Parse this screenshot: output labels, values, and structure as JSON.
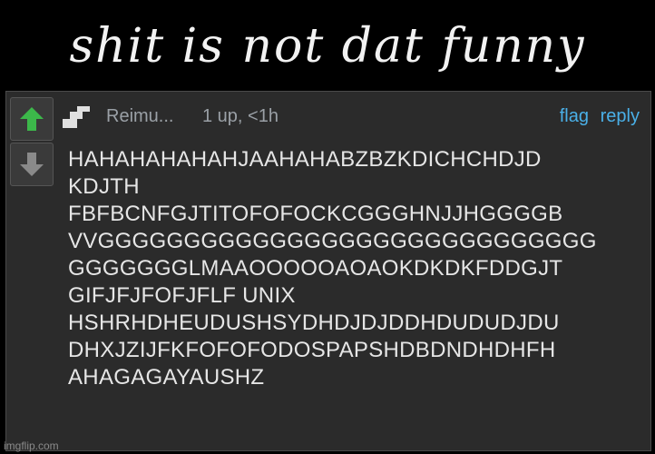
{
  "caption": "shit is not dat funny",
  "comment": {
    "username": "Reimu...",
    "meta": "1 up, <1h",
    "actions": {
      "flag": "flag",
      "reply": "reply"
    },
    "lines": [
      "HAHAHAHAHAHJAAHAHABZBZKDICHCHDJD",
      "KDJTH",
      "FBFBCNFGJTITOFOFOCKCGGGHNJJHGGGGB",
      "VVGGGGGGGGGGGGGGGGGGGGGGGGGGGGG",
      "GGGGGGGLMAAOOOOOAOAOKDKDKFDDGJT",
      "GIFJFJFOFJFLF UNIX",
      "HSHRHDHEUDUSHSYDHDJDJDDHDUDUDJDU",
      "DHXJZIJFKFOFOFODOSPAPSHDBDNDHDHFH",
      "AHAGAGAYAUSHZ"
    ],
    "icons": {
      "upvote": "up-arrow-icon",
      "downvote": "down-arrow-icon",
      "avatar": "avatar-icon"
    },
    "colors": {
      "upvote": "#3cb84a",
      "downvote": "#8a8a8a",
      "link": "#4ab0e8"
    }
  },
  "watermark": "imgflip.com"
}
